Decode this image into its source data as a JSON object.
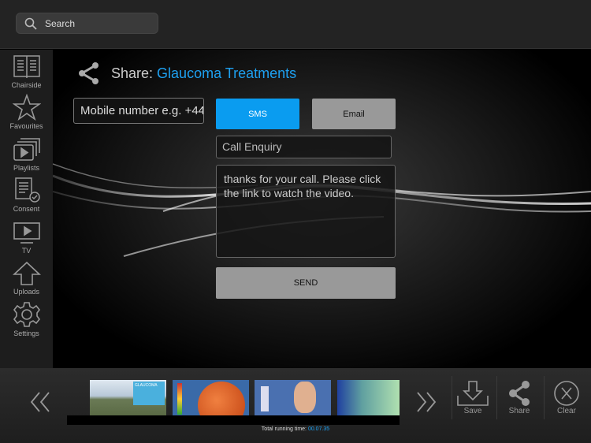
{
  "search": {
    "placeholder": "Search",
    "icon": "search-icon"
  },
  "sidebar": {
    "items": [
      {
        "label": "Chairside",
        "icon": "book-icon"
      },
      {
        "label": "Favourites",
        "icon": "star-icon"
      },
      {
        "label": "Playlists",
        "icon": "playlist-icon"
      },
      {
        "label": "Consent",
        "icon": "consent-icon"
      },
      {
        "label": "TV",
        "icon": "tv-icon"
      },
      {
        "label": "Uploads",
        "icon": "upload-icon"
      },
      {
        "label": "Settings",
        "icon": "gear-icon"
      }
    ]
  },
  "share": {
    "prefix": "Share:",
    "title": "Glaucoma Treatments",
    "mobile_placeholder": "Mobile number e.g. +44",
    "sms_label": "SMS",
    "email_label": "Email",
    "subject": "Call Enquiry",
    "message": "thanks for your call.  Please click the link to watch the video.",
    "send_label": "SEND"
  },
  "colors": {
    "accent": "#0a9cf0"
  },
  "bottom": {
    "thumb1_caption": "GLAUCOMA",
    "runtime_label": "Total running time:",
    "runtime_value": "00.07.35",
    "save_label": "Save",
    "share_label": "Share",
    "clear_label": "Clear"
  }
}
